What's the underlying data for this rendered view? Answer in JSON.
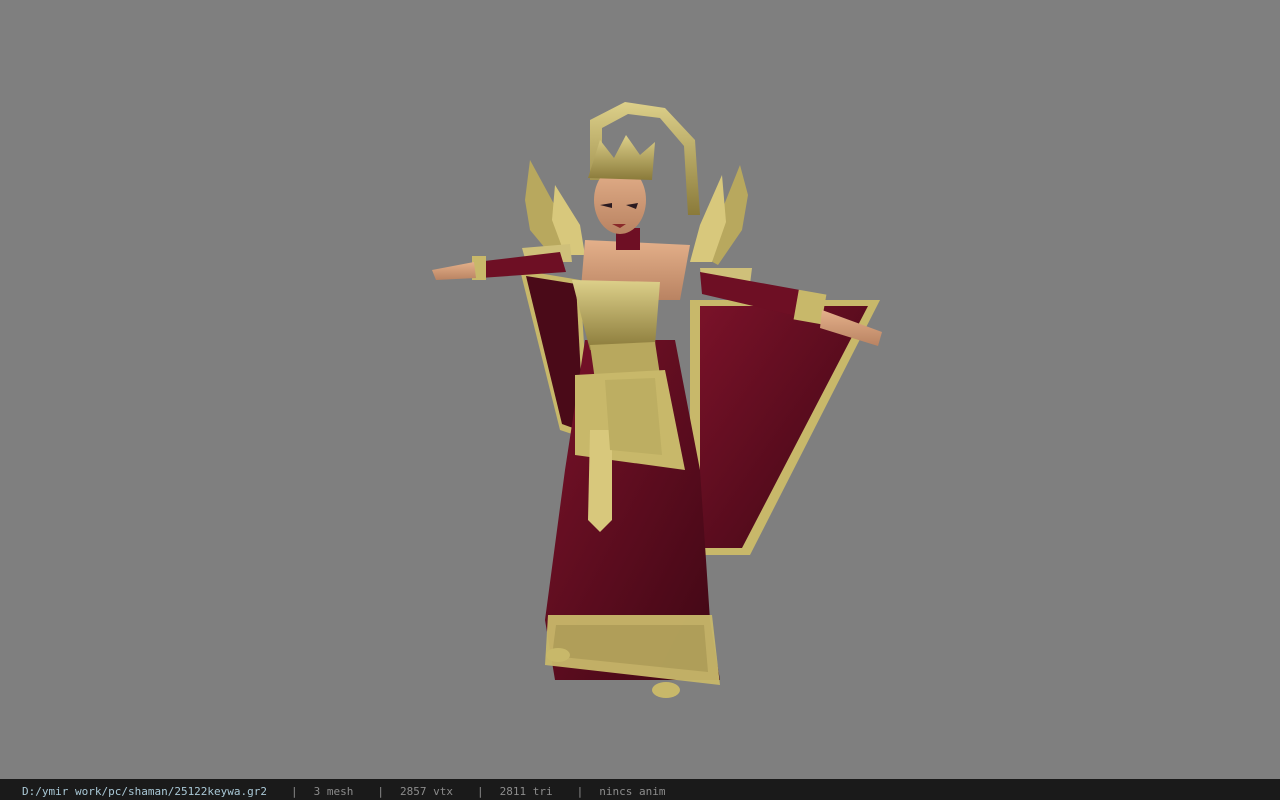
{
  "viewer": {
    "background_color": "#7f7f7f",
    "model_colors": {
      "robe": "#6e0f24",
      "robe_dark": "#3e0714",
      "gold": "#c8b86a",
      "gold_dark": "#8a7a3a",
      "skin": "#d9a37e"
    }
  },
  "statusbar": {
    "file_path": "D:/ymir work/pc/shaman/25122keywa.gr2",
    "separator": "|",
    "mesh_count": "3 mesh",
    "vertex_count": "2857 vtx",
    "triangle_count": "2811 tri",
    "animation": "nincs anim"
  }
}
